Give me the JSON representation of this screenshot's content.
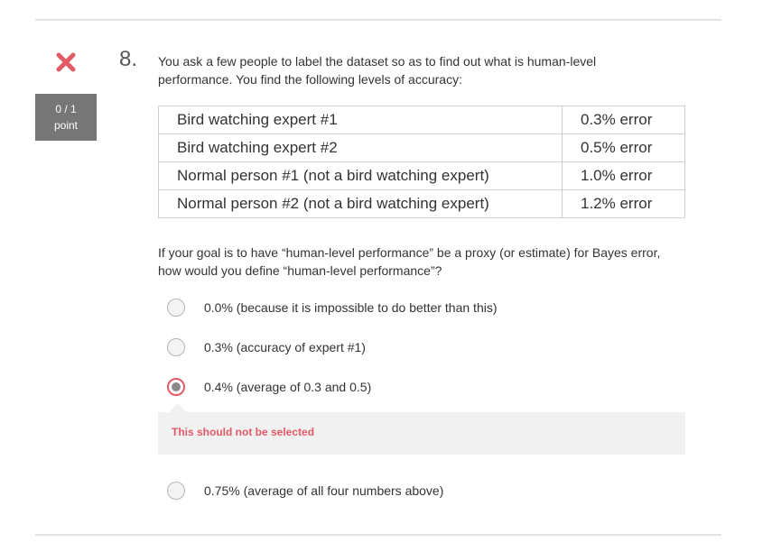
{
  "question": {
    "number": "8.",
    "score_line1": "0 / 1",
    "score_line2": "point",
    "prompt": "You ask a few people to label the dataset so as to find out what is human-level performance. You find the following levels of accuracy:",
    "table": [
      {
        "who": "Bird watching expert #1",
        "error": "0.3% error"
      },
      {
        "who": "Bird watching expert #2",
        "error": "0.5% error"
      },
      {
        "who": "Normal person #1 (not a bird watching expert)",
        "error": "1.0% error"
      },
      {
        "who": "Normal person #2 (not a bird watching expert)",
        "error": "1.2% error"
      }
    ],
    "followup": "If your goal is to have “human-level performance” be a proxy (or estimate) for Bayes error, how would you define “human-level performance”?",
    "options": [
      {
        "label": "0.0% (because it is impossible to do better than this)",
        "selected": false
      },
      {
        "label": "0.3% (accuracy of expert #1)",
        "selected": false
      },
      {
        "label": "0.4% (average of 0.3 and 0.5)",
        "selected": true
      },
      {
        "label": "0.75% (average of all four numbers above)",
        "selected": false
      }
    ],
    "feedback": "This should not be selected",
    "status_icon": "x-icon",
    "colors": {
      "incorrect": "#e35b67",
      "score_bg": "#767676",
      "feedback_bg": "#f1f1f1"
    }
  }
}
